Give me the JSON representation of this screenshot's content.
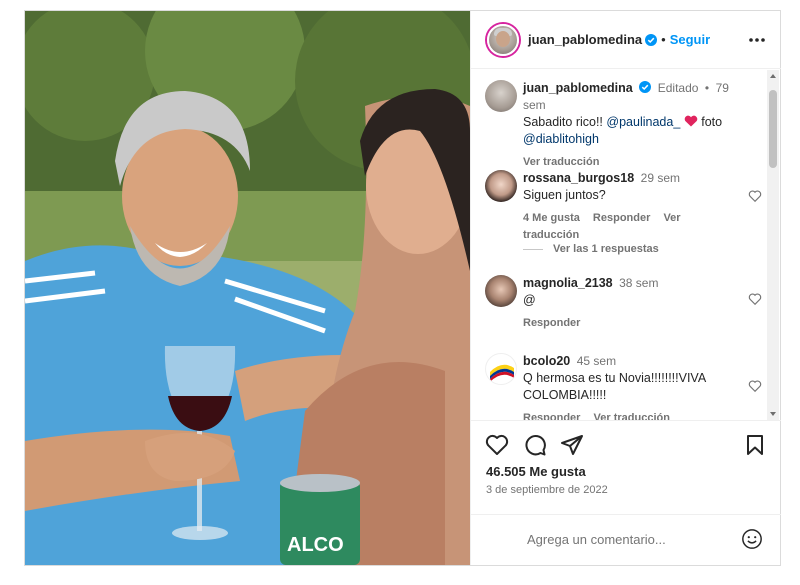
{
  "header": {
    "username": "juan_pablomedina",
    "separator": "•",
    "follow_label": "Seguir"
  },
  "caption": {
    "username": "juan_pablomedina",
    "edited": "Editado",
    "separator": "•",
    "time": "79 sem",
    "text": "Sabadito rico!!",
    "mention1": "@paulinada_",
    "after_heart": "foto",
    "mention2": "@diablitohigh",
    "translate": "Ver traducción"
  },
  "comments": [
    {
      "username": "rossana_burgos18",
      "time": "29 sem",
      "text": "Siguen juntos?",
      "likes": "4 Me gusta",
      "reply": "Responder",
      "translate": "Ver traducción"
    },
    {
      "username": "magnolia_2138",
      "time": "38 sem",
      "text": "@",
      "reply": "Responder"
    },
    {
      "username": "bcolo20",
      "time": "45 sem",
      "text": "Q hermosa es tu Novia!!!!!!!!VIVA COLOMBIA!!!!!",
      "reply": "Responder",
      "translate": "Ver traducción"
    }
  ],
  "view_replies": "Ver las 1 respuestas",
  "post": {
    "likes": "46.505 Me gusta",
    "date": "3 de septiembre de 2022"
  },
  "add_comment": {
    "placeholder": "Agrega un comentario..."
  },
  "colors": {
    "accent": "#0095f6",
    "verified": "#0095f6",
    "heart": "#ff3040",
    "muted": "#737373"
  }
}
